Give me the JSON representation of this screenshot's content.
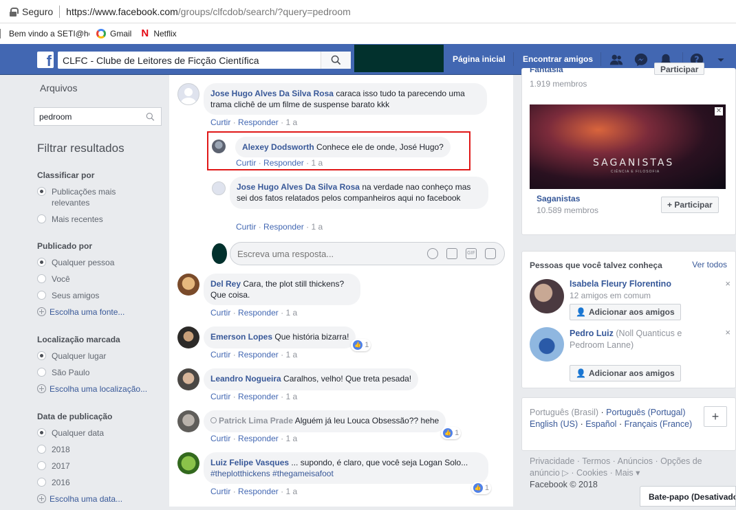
{
  "browser": {
    "secure_label": "Seguro",
    "url_domain": "https://www.facebook.com",
    "url_path": "/groups/clfcdob/search/?query=pedroom",
    "bookmarks": [
      "Bem vindo a SETI@ho",
      "Gmail",
      "Netflix"
    ]
  },
  "header": {
    "search_value": "CLFC - Clube de Leitores de Ficção Científica",
    "nav": [
      "Página inicial",
      "Encontrar amigos"
    ]
  },
  "sidebar": {
    "archives": "Arquivos",
    "search_value": "pedroom",
    "filter_title": "Filtrar resultados",
    "sort": {
      "title": "Classificar por",
      "options": [
        "Publicações mais relevantes",
        "Mais recentes"
      ]
    },
    "posted_by": {
      "title": "Publicado por",
      "options": [
        "Qualquer pessoa",
        "Você",
        "Seus amigos"
      ],
      "link": "Escolha uma fonte..."
    },
    "location": {
      "title": "Localização marcada",
      "options": [
        "Qualquer lugar",
        "São Paulo"
      ],
      "link": "Escolha uma localização..."
    },
    "date": {
      "title": "Data de publicação",
      "options": [
        "Qualquer data",
        "2018",
        "2017",
        "2016"
      ],
      "link": "Escolha uma data..."
    }
  },
  "actions": {
    "like": "Curtir",
    "reply": "Responder",
    "time": "1 a",
    "dot": "·"
  },
  "comments": [
    {
      "author": "Jose Hugo Alves Da Silva Rosa",
      "text": "caraca isso tudo ta parecendo uma trama clichê de um filme de suspense barato kkk"
    },
    {
      "author": "Alexey Dodsworth",
      "text": "Conhece ele de onde, José Hugo?"
    },
    {
      "author": "Jose Hugo Alves Da Silva Rosa",
      "text": "na verdade nao conheço mas sei dos fatos relatados pelos companheiros aqui no facebook"
    },
    {
      "author": "Del Rey",
      "text": "Cara, the plot still thickens? Que coisa."
    },
    {
      "author": "Emerson Lopes",
      "text": "Que história bizarra!",
      "likes": "1"
    },
    {
      "author": "Leandro Nogueira",
      "text": "Caralhos, velho! Que treta pesada!"
    },
    {
      "author": "Patrick Lima Prade",
      "text": "Alguém já leu Louca Obsessão?? hehe",
      "likes": "1"
    },
    {
      "author": "Luiz Felipe Vasques",
      "text": "... supondo, é claro, que você seja Logan Solo...",
      "tags": "#theplotthickens #thegameisafoot",
      "likes": "1"
    }
  ],
  "reply_placeholder": "Escreva uma resposta...",
  "right": {
    "top_group_name": "Fantasia",
    "top_group_members": "1.919 membros",
    "top_group_join": "Participar",
    "promo_group": {
      "banner_title": "SAGANISTAS",
      "banner_sub": "CIÊNCIA E FILOSOFIA",
      "name": "Saganistas",
      "members": "10.589 membros",
      "join": "+ Participar"
    },
    "pymk": {
      "title": "Pessoas que você talvez conheça",
      "see_all": "Ver todos",
      "people": [
        {
          "name": "Isabela Fleury Florentino",
          "sub": "12 amigos em comum",
          "button": "Adicionar aos amigos"
        },
        {
          "name": "Pedro Luiz",
          "sub": "(Noll Quanticus e Pedroom Lanne)",
          "button": "Adicionar aos amigos"
        }
      ]
    },
    "languages": {
      "current": "Português (Brasil)",
      "others": [
        "Português (Portugal)",
        "English (US)",
        "Español",
        "Français (France)"
      ]
    },
    "footer": {
      "links": [
        "Privacidade",
        "Termos",
        "Anúncios",
        "Opções de anúncio",
        "Cookies",
        "Mais"
      ],
      "copyright": "Facebook © 2018"
    },
    "chat": "Bate-papo (Desativado)"
  }
}
